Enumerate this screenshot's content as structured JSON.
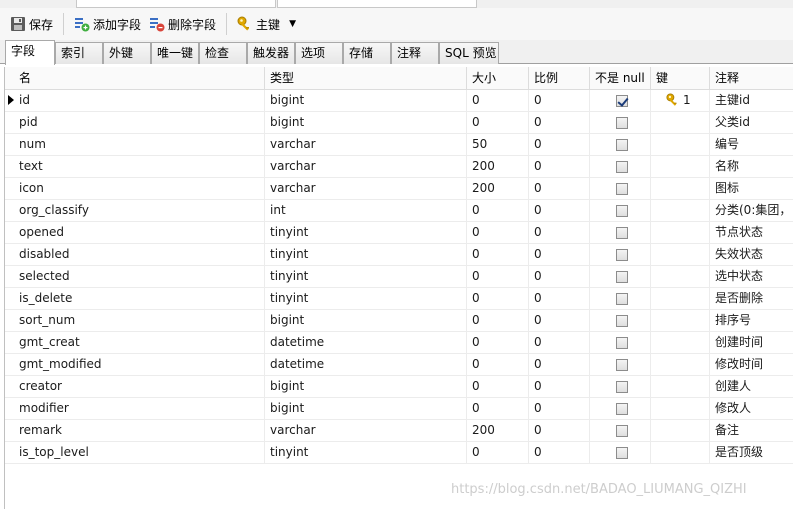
{
  "toolbar": {
    "save_label": "保存",
    "add_field_label": "添加字段",
    "delete_field_label": "删除字段",
    "primary_key_label": "主键"
  },
  "tabs": [
    "字段",
    "索引",
    "外键",
    "唯一键",
    "检查",
    "触发器",
    "选项",
    "存储",
    "注释",
    "SQL 预览"
  ],
  "columns": [
    "名",
    "类型",
    "大小",
    "比例",
    "不是 null",
    "键",
    "注释"
  ],
  "rows": [
    {
      "name": "id",
      "type": "bigint",
      "size": "0",
      "scale": "0",
      "not_null": true,
      "key": "1",
      "comment": "主键id",
      "current": true
    },
    {
      "name": "pid",
      "type": "bigint",
      "size": "0",
      "scale": "0",
      "not_null": false,
      "key": "",
      "comment": "父类id"
    },
    {
      "name": "num",
      "type": "varchar",
      "size": "50",
      "scale": "0",
      "not_null": false,
      "key": "",
      "comment": "编号"
    },
    {
      "name": "text",
      "type": "varchar",
      "size": "200",
      "scale": "0",
      "not_null": false,
      "key": "",
      "comment": "名称"
    },
    {
      "name": "icon",
      "type": "varchar",
      "size": "200",
      "scale": "0",
      "not_null": false,
      "key": "",
      "comment": "图标"
    },
    {
      "name": "org_classify",
      "type": "int",
      "size": "0",
      "scale": "0",
      "not_null": false,
      "key": "",
      "comment": "分类(0:集团，"
    },
    {
      "name": "opened",
      "type": "tinyint",
      "size": "0",
      "scale": "0",
      "not_null": false,
      "key": "",
      "comment": "节点状态"
    },
    {
      "name": "disabled",
      "type": "tinyint",
      "size": "0",
      "scale": "0",
      "not_null": false,
      "key": "",
      "comment": "失效状态"
    },
    {
      "name": "selected",
      "type": "tinyint",
      "size": "0",
      "scale": "0",
      "not_null": false,
      "key": "",
      "comment": "选中状态"
    },
    {
      "name": "is_delete",
      "type": "tinyint",
      "size": "0",
      "scale": "0",
      "not_null": false,
      "key": "",
      "comment": "是否删除"
    },
    {
      "name": "sort_num",
      "type": "bigint",
      "size": "0",
      "scale": "0",
      "not_null": false,
      "key": "",
      "comment": "排序号"
    },
    {
      "name": "gmt_creat",
      "type": "datetime",
      "size": "0",
      "scale": "0",
      "not_null": false,
      "key": "",
      "comment": "创建时间"
    },
    {
      "name": "gmt_modified",
      "type": "datetime",
      "size": "0",
      "scale": "0",
      "not_null": false,
      "key": "",
      "comment": "修改时间"
    },
    {
      "name": "creator",
      "type": "bigint",
      "size": "0",
      "scale": "0",
      "not_null": false,
      "key": "",
      "comment": "创建人"
    },
    {
      "name": "modifier",
      "type": "bigint",
      "size": "0",
      "scale": "0",
      "not_null": false,
      "key": "",
      "comment": "修改人"
    },
    {
      "name": "remark",
      "type": "varchar",
      "size": "200",
      "scale": "0",
      "not_null": false,
      "key": "",
      "comment": "备注"
    },
    {
      "name": "is_top_level",
      "type": "tinyint",
      "size": "0",
      "scale": "0",
      "not_null": false,
      "key": "",
      "comment": "是否顶级"
    }
  ],
  "watermark": "https://blog.csdn.net/BADAO_LIUMANG_QIZHI",
  "colors": {
    "key_gold": "#e0a800",
    "add_green": "#3fae3f",
    "delete_red": "#d9443a",
    "field_blue": "#3b6fc4"
  }
}
